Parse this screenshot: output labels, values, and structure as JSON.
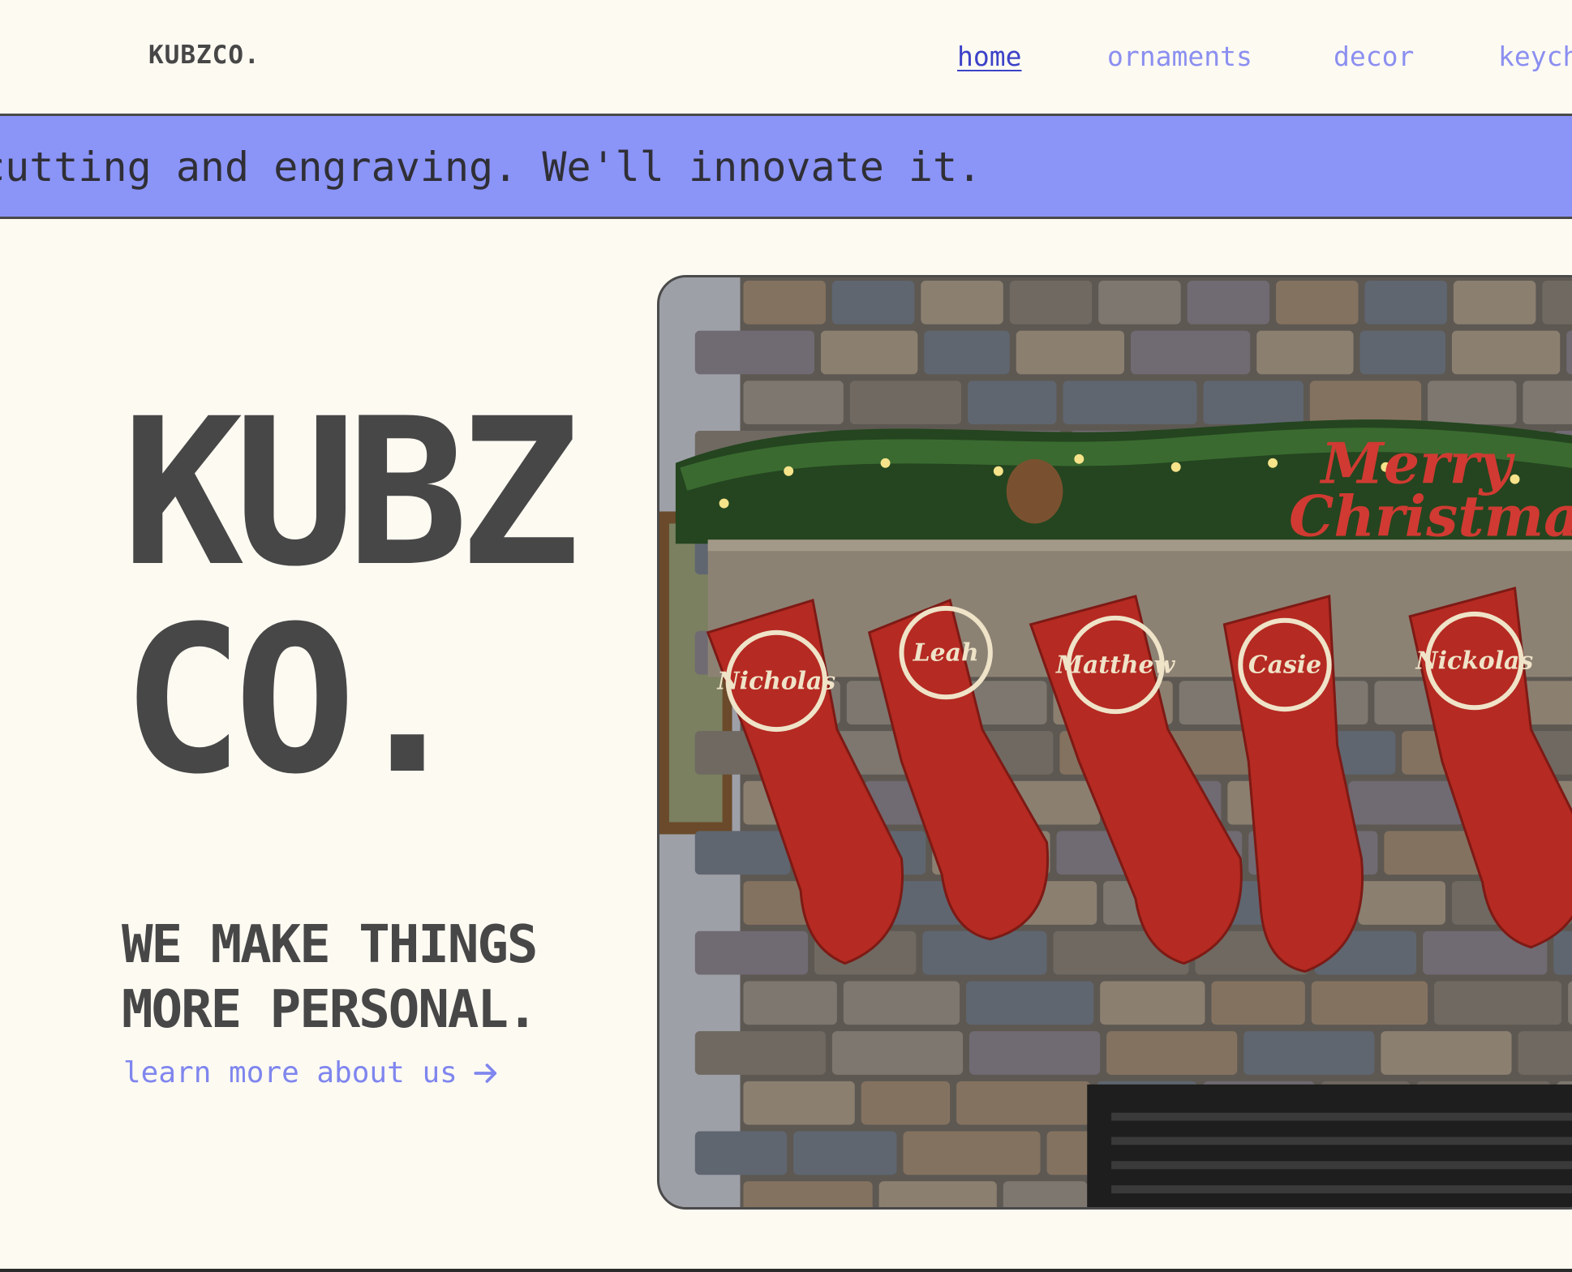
{
  "header": {
    "brand": "KUBZCO.",
    "nav": [
      {
        "label": "home",
        "active": true
      },
      {
        "label": "ornaments",
        "active": false
      },
      {
        "label": "decor",
        "active": false
      },
      {
        "label": "keych",
        "active": false
      }
    ]
  },
  "banner": {
    "text": "cutting and engraving. We'll innovate it."
  },
  "hero": {
    "title_line_1": "KUBZ",
    "title_line_2": "CO.",
    "tagline_line_1": "WE MAKE THINGS",
    "tagline_line_2": "MORE PERSONAL.",
    "learn_more": "learn more about us",
    "learn_more_icon": "arrow-right-icon"
  },
  "photo": {
    "ornament_names": [
      "Nicholas",
      "Leah",
      "Matthew",
      "Casie",
      "Nickolas"
    ],
    "sign_line_1": "Merry",
    "sign_line_2": "Christmas"
  },
  "colors": {
    "background": "#fdfaf2",
    "text": "#474747",
    "accent": "#8b94f7",
    "link": "#8b8ff0",
    "active_link": "#3c42c8",
    "stocking": "#b52a22"
  }
}
